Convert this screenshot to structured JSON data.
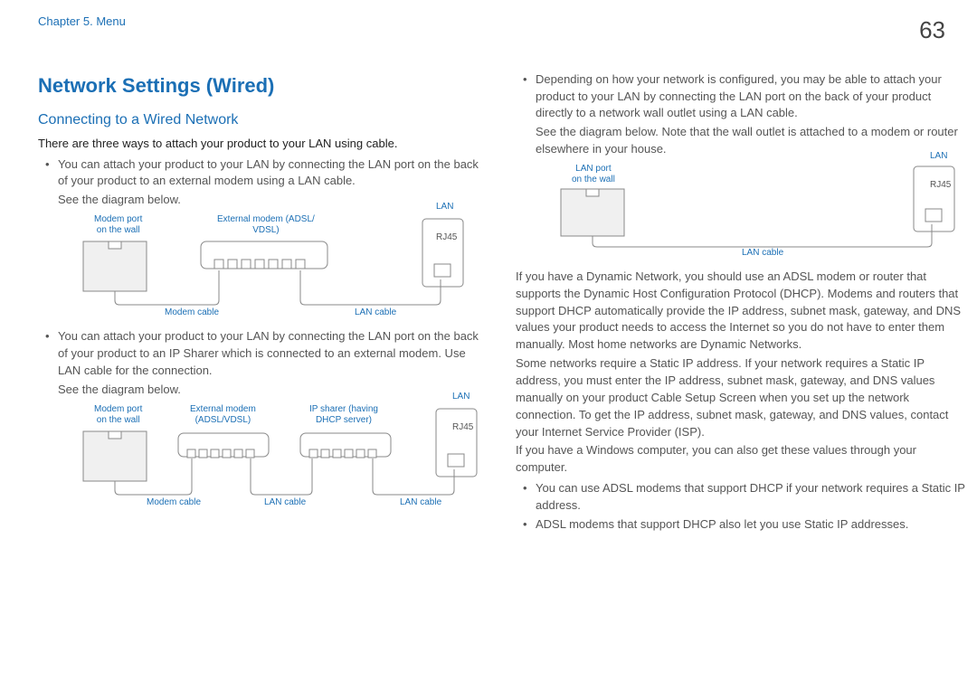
{
  "header": {
    "chapter": "Chapter 5. Menu",
    "page": "63"
  },
  "left": {
    "h1": "Network Settings (Wired)",
    "h2": "Connecting to a Wired Network",
    "intro": "There are three ways to attach your product to your LAN using cable.",
    "b1": "You can attach your product to your LAN by connecting the LAN port on the back of your product to an external modem using a LAN cable.",
    "see1": "See the diagram below.",
    "b2": "You can attach your product to your LAN by connecting the LAN port on the back of your product to an IP Sharer which is connected to an external modem. Use LAN cable for the connection.",
    "see2": "See the diagram below."
  },
  "right": {
    "b3": "Depending on how your network is configured, you may be able to attach your product to your LAN by connecting the LAN port on the back of your product directly to a network wall outlet using a LAN cable.",
    "see3": "See the diagram below. Note that the wall outlet is attached to a modem or router elsewhere in your house.",
    "p1": "If you have a Dynamic Network, you should use an ADSL modem or router that supports the Dynamic Host Configuration Protocol (DHCP). Modems and routers that support DHCP automatically provide the IP address, subnet mask, gateway, and DNS values your product needs to access the Internet so you do not have to enter them manually. Most home networks are Dynamic Networks.",
    "p2": "Some networks require a Static IP address. If your network requires a Static IP address, you must enter the IP address, subnet mask, gateway, and DNS values manually on your product Cable Setup Screen when you set up the network connection. To get the IP address, subnet mask, gateway, and DNS values, contact your Internet Service Provider (ISP).",
    "p3": "If you have a Windows computer, you can also get these values through your computer.",
    "b4": "You can use ADSL modems that support DHCP if your network requires a Static IP address.",
    "b5": "ADSL modems that support DHCP also let you use Static IP addresses."
  },
  "labels": {
    "modem_port": "Modem port",
    "on_the_wall": "on the wall",
    "ext_modem_adsl_vdsl": "External modem (ADSL/",
    "vdsl_close": "VDSL)",
    "ext_modem": "External modem",
    "adsl_vdsl": "(ADSL/VDSL)",
    "ip_sharer": "IP sharer (having",
    "dhcp_server": "DHCP server)",
    "lan": "LAN",
    "rj45": "RJ45",
    "modem_cable": "Modem cable",
    "lan_cable": "LAN cable",
    "lan_port": "LAN port"
  }
}
